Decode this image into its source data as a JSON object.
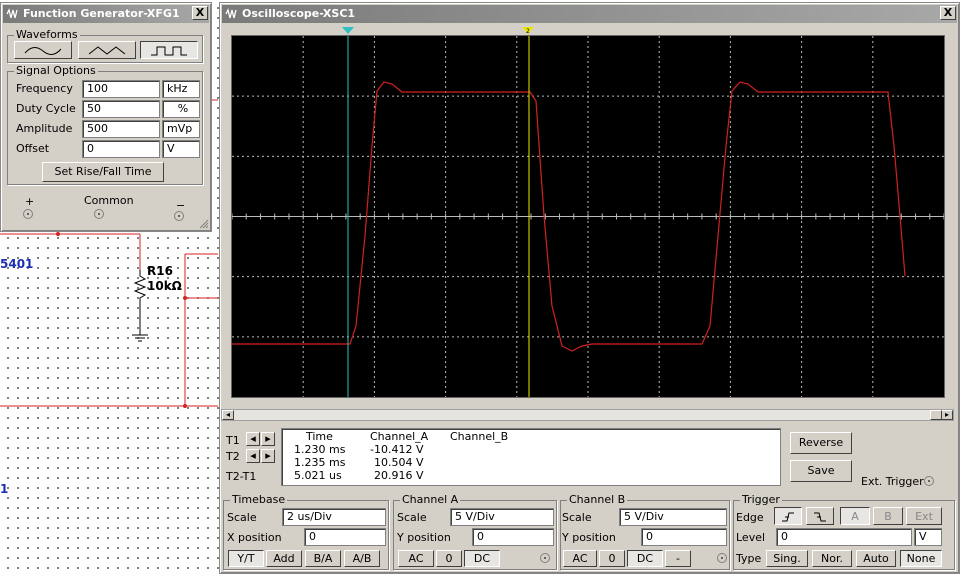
{
  "schematic": {
    "left_label_1": "5401",
    "left_label_2": "1",
    "resistor_name": "R16",
    "resistor_value": "10kΩ"
  },
  "function_generator": {
    "title": "Function Generator-XFG1",
    "close": "X",
    "waveforms_label": "Waveforms",
    "signal_options_label": "Signal Options",
    "frequency_label": "Frequency",
    "frequency_value": "100",
    "frequency_unit": "kHz",
    "duty_label": "Duty Cycle",
    "duty_value": "50",
    "duty_unit": "%",
    "amplitude_label": "Amplitude",
    "amplitude_value": "500",
    "amplitude_unit": "mVp",
    "offset_label": "Offset",
    "offset_value": "0",
    "offset_unit": "V",
    "rise_fall_button": "Set Rise/Fall Time",
    "plus_label": "+",
    "common_label": "Common",
    "minus_label": "−",
    "selected_waveform": "square"
  },
  "oscilloscope": {
    "title": "Oscilloscope-XSC1",
    "close": "X",
    "readout": {
      "headers": [
        "Time",
        "Channel_A",
        "Channel_B"
      ],
      "rows": [
        {
          "label": "T1",
          "time": "1.230 ms",
          "a": "-10.412 V",
          "b": ""
        },
        {
          "label": "T2",
          "time": "1.235 ms",
          "a": "10.504 V",
          "b": ""
        },
        {
          "label": "T2-T1",
          "time": "5.021 us",
          "a": "20.916 V",
          "b": ""
        }
      ]
    },
    "reverse_button": "Reverse",
    "save_button": "Save",
    "ext_trigger_label": "Ext. Trigger",
    "timebase": {
      "group_label": "Timebase",
      "scale_label": "Scale",
      "scale_value": "2 us/Div",
      "xpos_label": "X position",
      "xpos_value": "0",
      "buttons": [
        "Y/T",
        "Add",
        "B/A",
        "A/B"
      ]
    },
    "channel_a": {
      "group_label": "Channel A",
      "scale_label": "Scale",
      "scale_value": "5  V/Div",
      "ypos_label": "Y position",
      "ypos_value": "0",
      "buttons": [
        "AC",
        "0",
        "DC"
      ]
    },
    "channel_b": {
      "group_label": "Channel B",
      "scale_label": "Scale",
      "scale_value": "5  V/Div",
      "ypos_label": "Y position",
      "ypos_value": "0",
      "buttons": [
        "AC",
        "0",
        "DC",
        "-"
      ]
    },
    "trigger": {
      "group_label": "Trigger",
      "edge_label": "Edge",
      "source_buttons": [
        "A",
        "B",
        "Ext"
      ],
      "level_label": "Level",
      "level_value": "0",
      "level_unit": "V",
      "type_label": "Type",
      "type_buttons": [
        "Sing.",
        "Nor.",
        "Auto",
        "None"
      ]
    },
    "colors": {
      "trace": "#d42020",
      "cursor_1": "#30c0c0",
      "cursor_2": "#e8e800",
      "screen": "#000000",
      "grid": "#bbbbbb"
    }
  }
}
